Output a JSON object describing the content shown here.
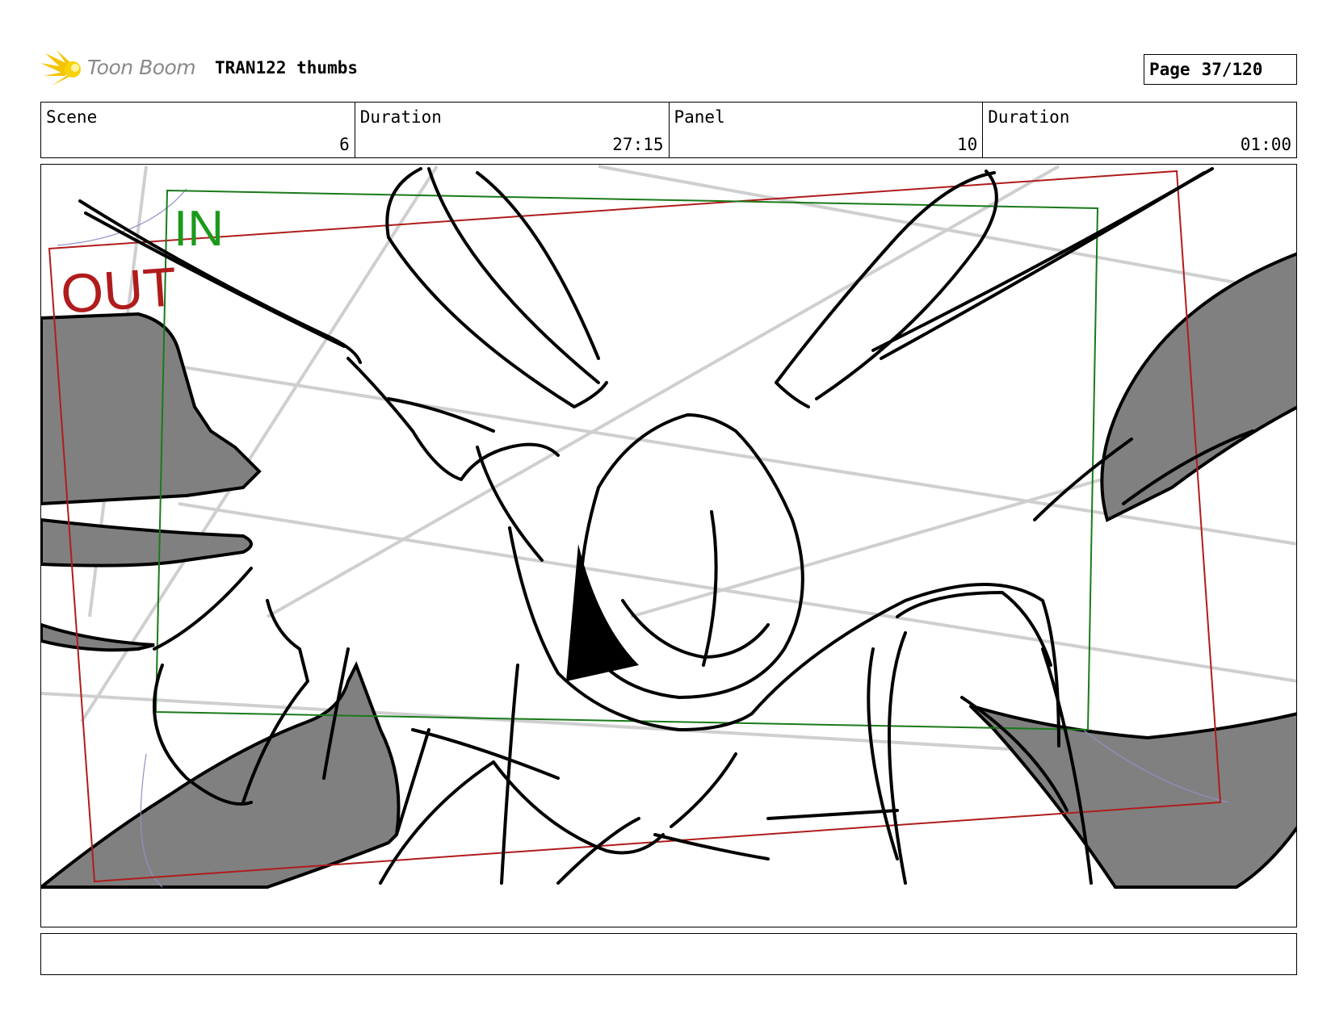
{
  "header": {
    "logo_text": "Toon Boom",
    "project_title": "TRAN122 thumbs",
    "page_label": "Page",
    "page_value": "37/120"
  },
  "info": {
    "scene_label": "Scene",
    "scene_value": "6",
    "scene_duration_label": "Duration",
    "scene_duration_value": "27:15",
    "panel_label": "Panel",
    "panel_value": "10",
    "panel_duration_label": "Duration",
    "panel_duration_value": "01:00"
  },
  "frame": {
    "in_label": "IN",
    "out_label": "OUT",
    "in_color": "#1a9a1a",
    "out_color": "#b01c1c"
  },
  "caption": {
    "text": ""
  }
}
